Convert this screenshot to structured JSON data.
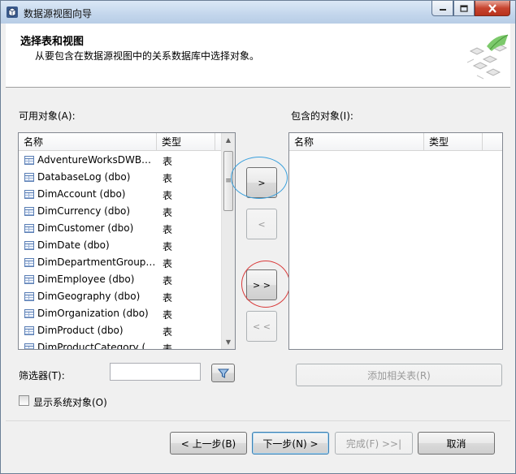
{
  "window": {
    "title": "数据源视图向导"
  },
  "header": {
    "title": "选择表和视图",
    "subtitle": "从要包含在数据源视图中的关系数据库中选择对象。"
  },
  "available": {
    "label": "可用对象(A):",
    "col_name": "名称",
    "col_type": "类型",
    "items": [
      {
        "name": "AdventureWorksDWBuildVersion (dbo)",
        "type": "表"
      },
      {
        "name": "DatabaseLog (dbo)",
        "type": "表"
      },
      {
        "name": "DimAccount (dbo)",
        "type": "表"
      },
      {
        "name": "DimCurrency (dbo)",
        "type": "表"
      },
      {
        "name": "DimCustomer (dbo)",
        "type": "表"
      },
      {
        "name": "DimDate (dbo)",
        "type": "表"
      },
      {
        "name": "DimDepartmentGroup (dbo)",
        "type": "表"
      },
      {
        "name": "DimEmployee (dbo)",
        "type": "表"
      },
      {
        "name": "DimGeography (dbo)",
        "type": "表"
      },
      {
        "name": "DimOrganization (dbo)",
        "type": "表"
      },
      {
        "name": "DimProduct (dbo)",
        "type": "表"
      },
      {
        "name": "DimProductCategory (dbo)",
        "type": "表"
      }
    ],
    "scroll_grip": "≡"
  },
  "included": {
    "label": "包含的对象(I):",
    "col_name": "名称",
    "col_type": "类型"
  },
  "move_buttons": {
    "add": ">",
    "remove": "<",
    "add_all": "> >",
    "remove_all": "< <"
  },
  "filter": {
    "label": "筛选器(T):",
    "value": ""
  },
  "add_related_label": "添加相关表(R)",
  "show_system_label": "显示系统对象(O)",
  "footer": {
    "back": "< 上一步(B)",
    "next": "下一步(N) >",
    "finish": "完成(F) >>|",
    "cancel": "取消"
  },
  "colors": {
    "highlight_blue": "#3aa0dc",
    "highlight_red": "#d93a3a"
  }
}
